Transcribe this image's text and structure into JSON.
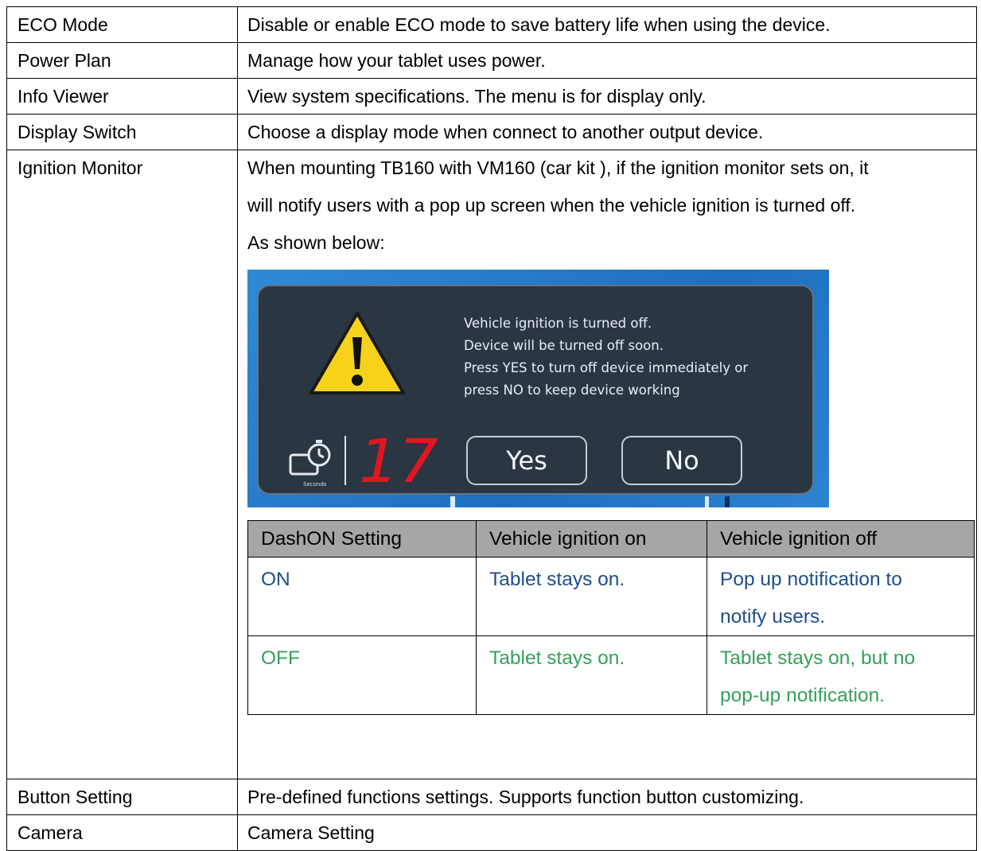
{
  "rows": [
    {
      "name": "ECO Mode",
      "desc": "Disable or enable ECO mode to save battery life when using the device."
    },
    {
      "name": "Power Plan",
      "desc": "Manage how your tablet uses power."
    },
    {
      "name": "Info Viewer",
      "desc": "View system specifications. The menu is for display only."
    },
    {
      "name": "Display Switch",
      "desc": "Choose a display mode when connect to another output device."
    },
    {
      "name": "Ignition Monitor"
    },
    {
      "name": "Button Setting",
      "desc": "Pre-defined functions settings. Supports function button customizing."
    },
    {
      "name": "Camera",
      "desc": "Camera Setting"
    }
  ],
  "ignition": {
    "line1": "When mounting TB160 with VM160 (car kit ), if the ignition monitor sets on, it",
    "line2": "will notify users with a pop up screen when the vehicle ignition is turned off.",
    "line3": "As shown below:"
  },
  "dialog": {
    "msg1": "Vehicle ignition is turned off.",
    "msg2": "Device will be turned off soon.",
    "msg3": "Press YES to turn off device immediately or",
    "msg4": "press NO to keep device working",
    "timer_label": "Seconds",
    "countdown": "17",
    "yes_label": "Yes",
    "no_label": "No",
    "icon_warning": "warning-icon",
    "icon_timer": "stopwatch-icon"
  },
  "dash_table": {
    "headers": [
      "DashON Setting",
      "Vehicle ignition on",
      "Vehicle ignition off"
    ],
    "on": {
      "setting": "ON",
      "ign_on": "Tablet stays on.",
      "ign_off_1": "Pop up notification to",
      "ign_off_2": "notify users."
    },
    "off": {
      "setting": "OFF",
      "ign_on": "Tablet stays on.",
      "ign_off_1": "Tablet stays on, but no",
      "ign_off_2": "pop-up notification."
    }
  },
  "colors": {
    "on_text": "#1f4e8a",
    "off_text": "#35a05c",
    "header_bg": "#a6a6a6",
    "dialog_bg": "#2b3643",
    "countdown": "#e0171f",
    "warning_fill": "#f7d21a"
  }
}
